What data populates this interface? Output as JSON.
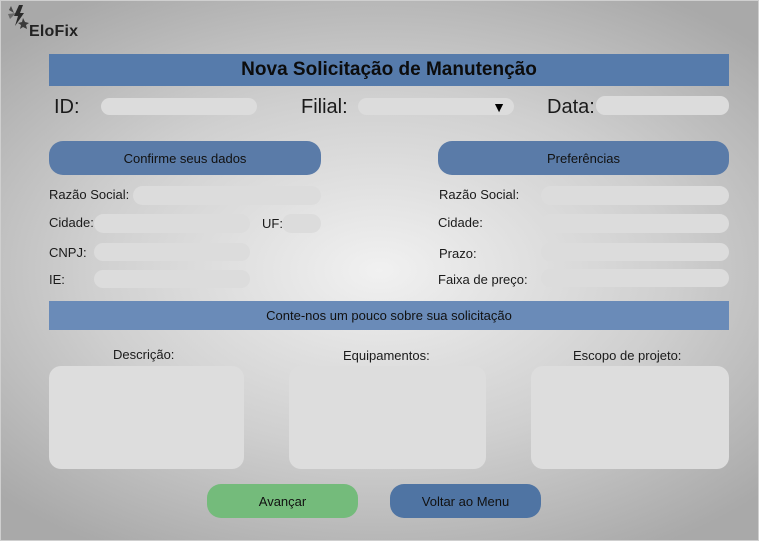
{
  "brand": {
    "name": "EloFix",
    "logo_icon": "lightning-star-icon"
  },
  "header": {
    "title": "Nova Solicitação de Manutenção"
  },
  "top_fields": {
    "id_label": "ID:",
    "id_value": "",
    "filial_label": "Filial:",
    "filial_value": "",
    "data_label": "Data:",
    "data_value": ""
  },
  "sections": {
    "confirm_label": "Confirme seus dados",
    "preferences_label": "Preferências",
    "request_label": "Conte-nos um pouco sobre sua solicitação"
  },
  "confirm_form": {
    "razao_social_label": "Razão Social:",
    "cidade_label": "Cidade:",
    "uf_label": "UF:",
    "cnpj_label": "CNPJ:",
    "ie_label": "IE:"
  },
  "preferences_form": {
    "razao_social_label": "Razão Social:",
    "cidade_label": "Cidade:",
    "prazo_label": "Prazo:",
    "faixa_label": "Faixa de preço:"
  },
  "request_form": {
    "descricao_label": "Descrição:",
    "equipamentos_label": "Equipamentos:",
    "escopo_label": "Escopo de projeto:"
  },
  "actions": {
    "advance_label": "Avançar",
    "menu_label": "Voltar ao Menu"
  },
  "colors": {
    "banner": "#567bab",
    "section_button": "#5a7ba8",
    "advance_button": "#74bb7b",
    "menu_button": "#4f74a3",
    "field": "#dcdcdc"
  }
}
